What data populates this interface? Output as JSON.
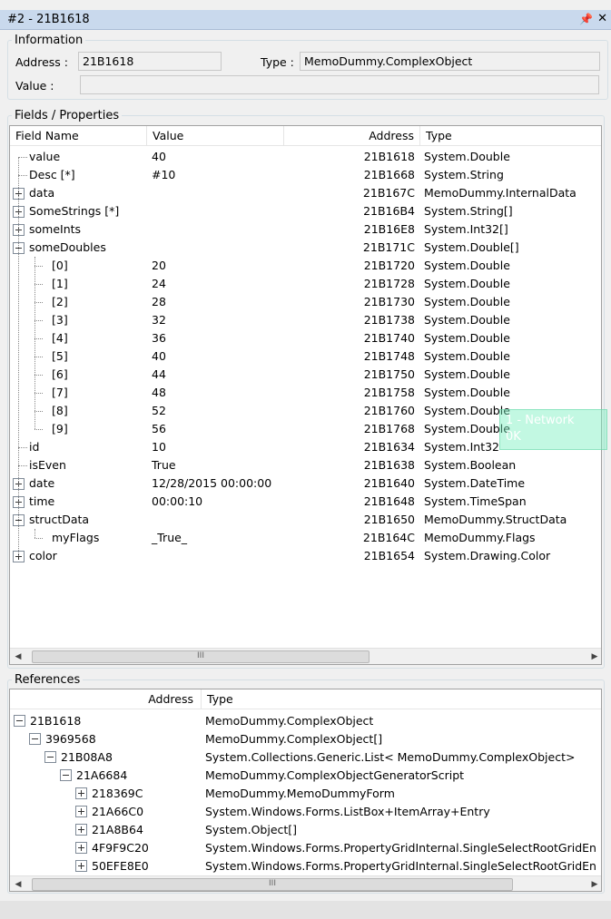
{
  "window": {
    "title": "#2 - 21B1618",
    "pin_icon": "pin-icon",
    "close_icon": "close-icon"
  },
  "information": {
    "title": "Information",
    "address_label": "Address :",
    "address_value": "21B1618",
    "type_label": "Type :",
    "type_value": "MemoDummy.ComplexObject",
    "value_label": "Value :",
    "value_value": ""
  },
  "fields": {
    "title": "Fields / Properties",
    "columns": [
      "Field Name",
      "Value",
      "Address",
      "Type"
    ],
    "rows": [
      {
        "name": "value",
        "value": "40",
        "address": "21B1618",
        "type": "System.Double",
        "level": 0,
        "expander": "none"
      },
      {
        "name": "Desc [*]",
        "value": "#10",
        "address": "21B1668",
        "type": "System.String",
        "level": 0,
        "expander": "none"
      },
      {
        "name": "data",
        "value": "",
        "address": "21B167C",
        "type": "MemoDummy.InternalData",
        "level": 0,
        "expander": "plus"
      },
      {
        "name": "SomeStrings [*]",
        "value": "",
        "address": "21B16B4",
        "type": "System.String[]",
        "level": 0,
        "expander": "plus"
      },
      {
        "name": "someInts",
        "value": "",
        "address": "21B16E8",
        "type": "System.Int32[]",
        "level": 0,
        "expander": "plus"
      },
      {
        "name": "someDoubles",
        "value": "",
        "address": "21B171C",
        "type": "System.Double[]",
        "level": 0,
        "expander": "minus"
      },
      {
        "name": "[0]",
        "value": "20",
        "address": "21B1720",
        "type": "System.Double",
        "level": 1,
        "expander": "none"
      },
      {
        "name": "[1]",
        "value": "24",
        "address": "21B1728",
        "type": "System.Double",
        "level": 1,
        "expander": "none"
      },
      {
        "name": "[2]",
        "value": "28",
        "address": "21B1730",
        "type": "System.Double",
        "level": 1,
        "expander": "none"
      },
      {
        "name": "[3]",
        "value": "32",
        "address": "21B1738",
        "type": "System.Double",
        "level": 1,
        "expander": "none"
      },
      {
        "name": "[4]",
        "value": "36",
        "address": "21B1740",
        "type": "System.Double",
        "level": 1,
        "expander": "none"
      },
      {
        "name": "[5]",
        "value": "40",
        "address": "21B1748",
        "type": "System.Double",
        "level": 1,
        "expander": "none"
      },
      {
        "name": "[6]",
        "value": "44",
        "address": "21B1750",
        "type": "System.Double",
        "level": 1,
        "expander": "none"
      },
      {
        "name": "[7]",
        "value": "48",
        "address": "21B1758",
        "type": "System.Double",
        "level": 1,
        "expander": "none"
      },
      {
        "name": "[8]",
        "value": "52",
        "address": "21B1760",
        "type": "System.Double",
        "level": 1,
        "expander": "none"
      },
      {
        "name": "[9]",
        "value": "56",
        "address": "21B1768",
        "type": "System.Double",
        "level": 1,
        "expander": "none"
      },
      {
        "name": "id",
        "value": "10",
        "address": "21B1634",
        "type": "System.Int32",
        "level": 0,
        "expander": "none"
      },
      {
        "name": "isEven",
        "value": "True",
        "address": "21B1638",
        "type": "System.Boolean",
        "level": 0,
        "expander": "none"
      },
      {
        "name": "date",
        "value": "12/28/2015 00:00:00",
        "address": "21B1640",
        "type": "System.DateTime",
        "level": 0,
        "expander": "plus"
      },
      {
        "name": "time",
        "value": "00:00:10",
        "address": "21B1648",
        "type": "System.TimeSpan",
        "level": 0,
        "expander": "plus"
      },
      {
        "name": "structData",
        "value": "",
        "address": "21B1650",
        "type": "MemoDummy.StructData",
        "level": 0,
        "expander": "minus"
      },
      {
        "name": "myFlags",
        "value": "_True_",
        "address": "21B164C",
        "type": "MemoDummy.Flags",
        "level": 1,
        "expander": "none"
      },
      {
        "name": "color",
        "value": "",
        "address": "21B1654",
        "type": "System.Drawing.Color",
        "level": 0,
        "expander": "plus"
      }
    ]
  },
  "references": {
    "title": "References",
    "columns": [
      "Address",
      "Type"
    ],
    "rows": [
      {
        "address": "21B1618",
        "type": "MemoDummy.ComplexObject",
        "level": 0,
        "expander": "minus"
      },
      {
        "address": "3969568",
        "type": "MemoDummy.ComplexObject[]",
        "level": 1,
        "expander": "minus"
      },
      {
        "address": "21B08A8",
        "type": "System.Collections.Generic.List< MemoDummy.ComplexObject>",
        "level": 2,
        "expander": "minus"
      },
      {
        "address": "21A6684",
        "type": "MemoDummy.ComplexObjectGeneratorScript",
        "level": 3,
        "expander": "minus"
      },
      {
        "address": "218369C",
        "type": "MemoDummy.MemoDummyForm",
        "level": 4,
        "expander": "plus"
      },
      {
        "address": "21A66C0",
        "type": "System.Windows.Forms.ListBox+ItemArray+Entry",
        "level": 4,
        "expander": "plus"
      },
      {
        "address": "21A8B64",
        "type": "System.Object[]",
        "level": 4,
        "expander": "plus"
      },
      {
        "address": "4F9F9C20",
        "type": "System.Windows.Forms.PropertyGridInternal.SingleSelectRootGridEn",
        "level": 4,
        "expander": "plus"
      },
      {
        "address": "50EFE8E0",
        "type": "System.Windows.Forms.PropertyGridInternal.SingleSelectRootGridEn",
        "level": 4,
        "expander": "plus"
      }
    ]
  },
  "scrollbar": {
    "left_arrow": "◀",
    "right_arrow": "▶",
    "grip": "III"
  },
  "tooltip": {
    "line1": "1 - Network",
    "line2": "0K"
  }
}
